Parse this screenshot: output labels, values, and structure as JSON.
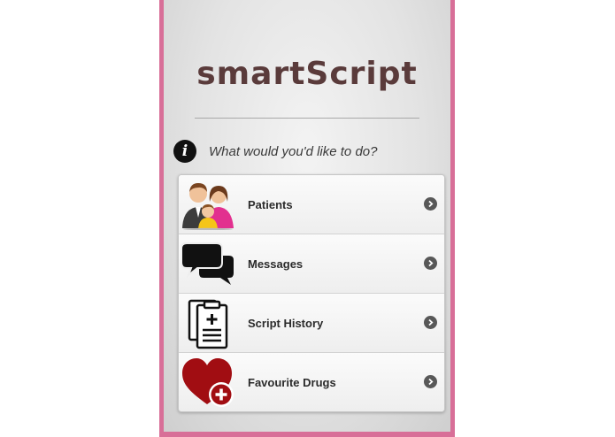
{
  "app": {
    "title": "smartScript",
    "prompt": "What would you'd like to do?",
    "frame_color": "#d86f98"
  },
  "menu": {
    "items": [
      {
        "label": "Patients",
        "icon": "patients-icon"
      },
      {
        "label": "Messages",
        "icon": "messages-icon"
      },
      {
        "label": "Script History",
        "icon": "script-history-icon"
      },
      {
        "label": "Favourite Drugs",
        "icon": "favourite-drugs-icon"
      }
    ]
  }
}
